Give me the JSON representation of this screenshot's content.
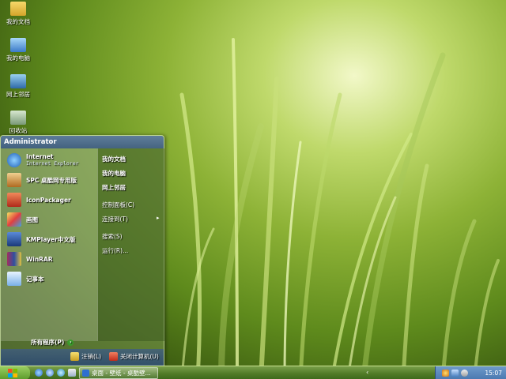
{
  "desktop": {
    "icons": [
      {
        "label": "我的文档",
        "icon": "folder-icon"
      },
      {
        "label": "我的电脑",
        "icon": "computer-icon"
      },
      {
        "label": "网上邻居",
        "icon": "network-icon"
      },
      {
        "label": "回收站",
        "icon": "recycle-bin-icon"
      }
    ]
  },
  "start_menu": {
    "user": "Administrator",
    "pinned": [
      {
        "label": "Internet",
        "sub": "Internet Explorer",
        "icon": "internet-explorer-icon"
      },
      {
        "label": "SPC 桌酷网专用版",
        "icon": "spc-icon"
      },
      {
        "label": "IconPackager",
        "icon": "iconpackager-icon"
      },
      {
        "label": "画图",
        "icon": "paint-icon"
      },
      {
        "label": "KMPlayer中文版",
        "icon": "kmplayer-icon"
      },
      {
        "label": "WinRAR",
        "icon": "winrar-icon"
      },
      {
        "label": "记事本",
        "icon": "notepad-icon"
      }
    ],
    "all_programs": "所有程序(P)",
    "right": [
      {
        "label": "我的文档",
        "bold": true
      },
      {
        "label": "我的电脑",
        "bold": true
      },
      {
        "label": "网上邻居",
        "bold": true
      },
      {
        "label": "控制面板(C)",
        "bold": false
      },
      {
        "label": "连接到(T)",
        "bold": false
      },
      {
        "label": "搜索(S)",
        "bold": false
      },
      {
        "label": "运行(R)...",
        "bold": false
      }
    ],
    "logoff": "注销(L)",
    "shutdown": "关闭计算机(U)"
  },
  "taskbar": {
    "task_label": "桌面 - 壁纸 - 桌酷壁...",
    "tray_chevron": "‹",
    "clock": "15:07"
  },
  "colors": {
    "start_button": "#5a9a2a",
    "tray": "#4a78b0",
    "header": "#3c5a8c"
  }
}
